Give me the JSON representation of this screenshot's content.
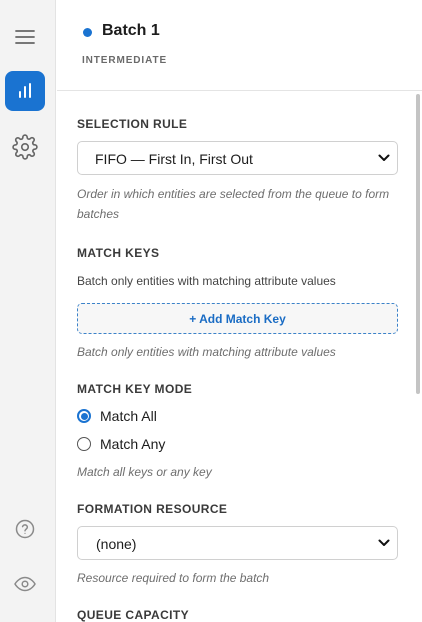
{
  "batch": {
    "title": "Batch 1",
    "subtitle": "INTERMEDIATE",
    "status_color": "#1a73d1"
  },
  "rail": {
    "items": [
      {
        "icon": "hamburger-menu-icon"
      },
      {
        "icon": "bar-chart-icon",
        "active": true
      },
      {
        "icon": "gear-icon"
      },
      {
        "icon": "help-circle-icon"
      },
      {
        "icon": "eye-icon"
      }
    ]
  },
  "selection_rule": {
    "title": "SELECTION RULE",
    "value": "FIFO — First In, First Out",
    "hint": "Order in which entities are selected from the queue to form batches"
  },
  "match_keys": {
    "title": "MATCH KEYS",
    "description": "Batch only entities with matching attribute values",
    "add_label": "+ Add Match Key",
    "hint": "Batch only entities with matching attribute values"
  },
  "match_key_mode": {
    "title": "MATCH KEY MODE",
    "options": [
      {
        "label": "Match All",
        "selected": true
      },
      {
        "label": "Match Any",
        "selected": false
      }
    ],
    "hint": "Match all keys or any key"
  },
  "formation_resource": {
    "title": "FORMATION RESOURCE",
    "value": "(none)",
    "hint": "Resource required to form the batch"
  },
  "queue_capacity": {
    "title": "QUEUE CAPACITY"
  },
  "accent_color": "#1a73d1"
}
